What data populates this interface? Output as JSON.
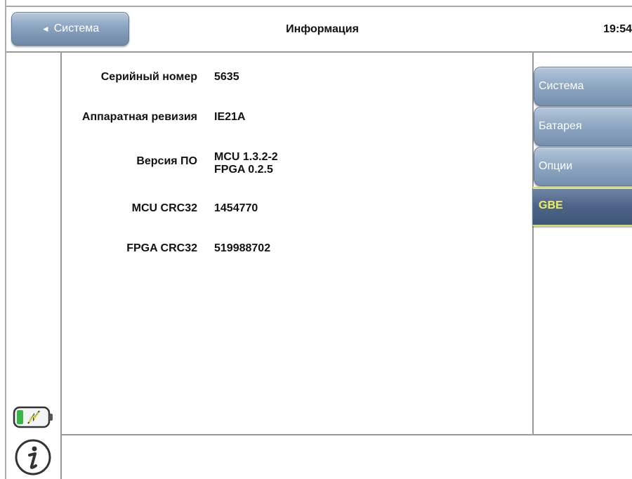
{
  "header": {
    "back_label": "Система",
    "title": "Информация",
    "time": "19:54"
  },
  "info": [
    {
      "label": "Серийный номер",
      "value": [
        "5635"
      ]
    },
    {
      "label": "Аппаратная ревизия",
      "value": [
        "IE21A"
      ]
    },
    {
      "label": "Версия ПО",
      "value": [
        "MCU 1.3.2-2",
        "FPGA 0.2.5"
      ]
    },
    {
      "label": "MCU CRC32",
      "value": [
        "1454770"
      ]
    },
    {
      "label": "FPGA CRC32",
      "value": [
        "519988702"
      ]
    }
  ],
  "tabs": [
    {
      "label": "Система",
      "active": false
    },
    {
      "label": "Батарея",
      "active": false
    },
    {
      "label": "Опции",
      "active": false
    },
    {
      "label": "GBE",
      "active": true
    }
  ],
  "icons": {
    "battery": "battery-charging-icon",
    "info": "info-icon"
  },
  "colors": {
    "button_blue": "#8aa3bf",
    "active_tab": "#4d6488",
    "active_tab_text": "#f0f05a",
    "battery_green": "#39b54a"
  }
}
